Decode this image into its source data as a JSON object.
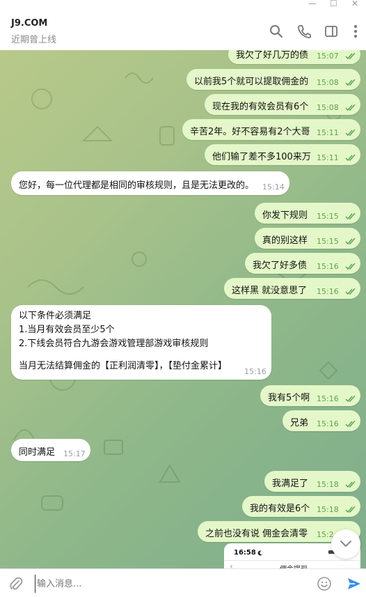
{
  "window": {
    "minimize": "—",
    "maximize": "☐",
    "close": "✕"
  },
  "header": {
    "title": "J9.COM",
    "status": "近期曾上线"
  },
  "messages": [
    {
      "dir": "out",
      "text": "我欠了好几万的债",
      "time": "15:07"
    },
    {
      "dir": "out",
      "text": "以前我5个就可以提取佣金的",
      "time": "15:08"
    },
    {
      "dir": "out",
      "text": "现在我的有效会员有6个",
      "time": "15:08"
    },
    {
      "dir": "out",
      "text": "辛苦2年。好不容易有2个大哥",
      "time": "15:11"
    },
    {
      "dir": "out",
      "text": "他们输了差不多100来万",
      "time": "15:11"
    },
    {
      "dir": "in",
      "text": "您好，每一位代理都是相同的审核规则，且是无法更改的。",
      "time": "15:14"
    },
    {
      "dir": "out",
      "text": "你发下规则",
      "time": "15:15"
    },
    {
      "dir": "out",
      "text": "真的别这样",
      "time": "15:15"
    },
    {
      "dir": "out",
      "text": "我欠了好多债",
      "time": "15:16"
    },
    {
      "dir": "out",
      "text": "这样黑 就没意思了",
      "time": "15:16"
    },
    {
      "dir": "in",
      "lines": [
        "以下条件必须满足",
        "1.当月有效会员至少5个",
        "2.下线会员符合九游会游戏管理部游戏审核规则",
        "",
        "当月无法结算佣金的【正利润清零】，【垫付金累计】"
      ],
      "time": "15:16"
    },
    {
      "dir": "out",
      "text": "我有5个啊",
      "time": "15:16"
    },
    {
      "dir": "out",
      "text": "兄弟",
      "time": "15:16"
    },
    {
      "dir": "in",
      "text": "同时满足",
      "time": "15:17"
    },
    {
      "dir": "out",
      "text": "我满足了",
      "time": "15:18"
    },
    {
      "dir": "out",
      "text": "我的有效是6个",
      "time": "15:18"
    },
    {
      "dir": "out",
      "text": "之前也没有说 佣金会清零",
      "time": "15:2"
    }
  ],
  "preview": {
    "time": "16:58",
    "title": "佣金提现"
  },
  "composer": {
    "placeholder": "输入消息..."
  },
  "colors": {
    "outgoing": "#e4f7c8",
    "incoming": "#ffffff",
    "accent": "#3390ec",
    "tick": "#5ca64f"
  }
}
